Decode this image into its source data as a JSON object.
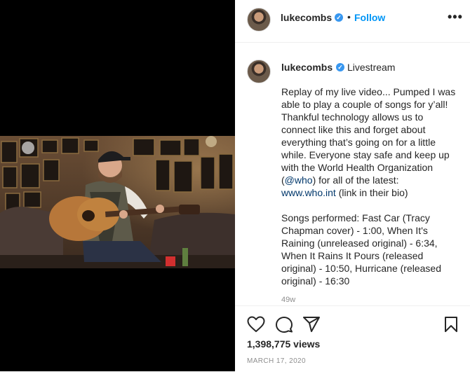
{
  "post": {
    "username": "lukecombs",
    "follow_label": "Follow",
    "separator": "•",
    "more_glyph": "•••",
    "location": "Livestream",
    "verified_glyph": "✓",
    "caption_lines_1": [
      "Replay of my live video... Pumped I was",
      "able to play a couple of songs for y’all!",
      "Thankful technology allows us to",
      "connect like this and forget about",
      "everything that’s going on for a little",
      "while. Everyone stay safe and keep up",
      "with the World Health Organization"
    ],
    "caption_mention_prefix": "(",
    "caption_mention": "@who",
    "caption_mention_suffix": ") for all of the latest:",
    "caption_link": "www.who.int",
    "caption_link_suffix": " (link in their bio)",
    "caption_lines_2": [
      "Songs performed: Fast Car (Tracy",
      "Chapman cover) - 1:00, When It's",
      "Raining (unreleased original) - 6:34,",
      "When It Rains It Pours (released",
      "original) - 10:50, Hurricane (released",
      "original) - 16:30"
    ],
    "time_ago": "49w",
    "views": "1,398,775 views",
    "date": "MARCH 17, 2020"
  },
  "icons": {
    "like": "heart-icon",
    "comment": "comment-icon",
    "share": "share-icon",
    "save": "bookmark-icon"
  }
}
